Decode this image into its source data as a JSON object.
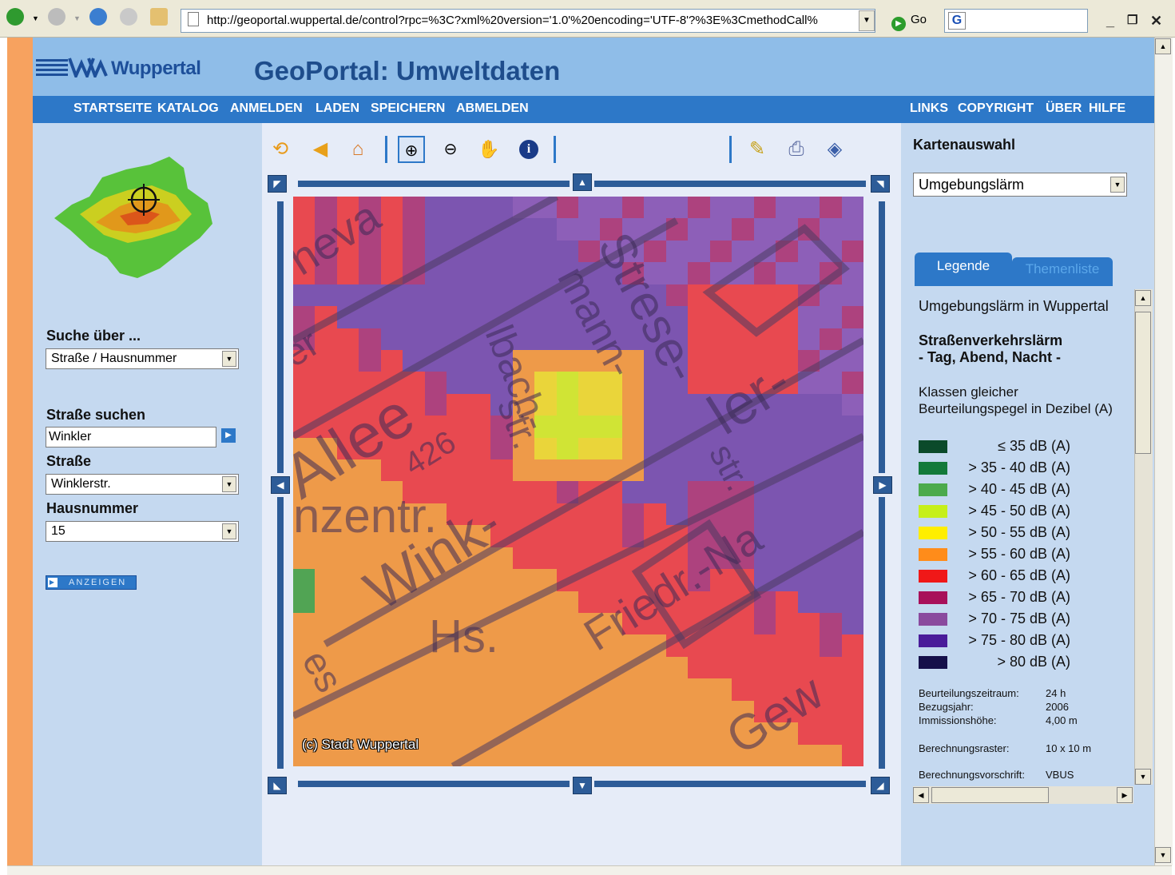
{
  "browser": {
    "url": "http://geoportal.wuppertal.de/control?rpc=%3C?xml%20version='1.0'%20encoding='UTF-8'?%3E%3CmethodCall%",
    "go_label": "Go"
  },
  "header": {
    "logo_text": "Wuppertal",
    "title": "GeoPortal: Umweltdaten"
  },
  "nav": {
    "left": [
      "STARTSEITE",
      "KATALOG",
      "ANMELDEN",
      "LADEN",
      "SPEICHERN",
      "ABMELDEN"
    ],
    "right": [
      "LINKS",
      "COPYRIGHT",
      "ÜBER",
      "HILFE"
    ]
  },
  "search": {
    "suche_label": "Suche über ...",
    "suche_value": "Straße / Hausnummer",
    "strasse_suchen_label": "Straße suchen",
    "strasse_suchen_value": "Winkler",
    "strasse_label": "Straße",
    "strasse_value": "Winklerstr.",
    "hausnummer_label": "Hausnummer",
    "hausnummer_value": "15",
    "anzeigen_label": "ANZEIGEN"
  },
  "map": {
    "copyright": "(c) Stadt Wuppertal",
    "labels": [
      "Allee",
      "Strese-",
      "mann-",
      "lbach-",
      "str.",
      "Wink-",
      "ler-",
      "str.",
      "Friedr.-Na",
      "Hs.",
      "nzentr.",
      "Gew",
      "heva",
      "426",
      "es",
      "er"
    ]
  },
  "kartenauswahl": {
    "title": "Kartenauswahl",
    "selected": "Umgebungslärm"
  },
  "tabs": {
    "legende": "Legende",
    "themenliste": "Themenliste"
  },
  "legend": {
    "title": "Umgebungslärm in Wuppertal",
    "subtitle1": "Straßenverkehrslärm",
    "subtitle2": "- Tag, Abend, Nacht -",
    "desc1": "Klassen gleicher",
    "desc2": "Beurteilungspegel in Dezibel (A)",
    "classes": [
      {
        "label": "≤ 35 dB (A)",
        "color": "#0b4a2a"
      },
      {
        "label": "> 35 - 40 dB (A)",
        "color": "#137a3a"
      },
      {
        "label": "> 40 - 45 dB (A)",
        "color": "#4caa4c"
      },
      {
        "label": "> 45 - 50 dB (A)",
        "color": "#c6ef1a"
      },
      {
        "label": "> 50 - 55 dB (A)",
        "color": "#ffee00"
      },
      {
        "label": "> 55 - 60 dB (A)",
        "color": "#ff8c1a"
      },
      {
        "label": "> 60 - 65 dB (A)",
        "color": "#f01818"
      },
      {
        "label": "> 65 - 70 dB (A)",
        "color": "#a8105a"
      },
      {
        "label": "> 70 - 75 dB (A)",
        "color": "#8a4a9e"
      },
      {
        "label": "> 75 - 80 dB (A)",
        "color": "#4a1c9a"
      },
      {
        "label": "> 80 dB (A)",
        "color": "#15104a"
      }
    ],
    "meta": [
      {
        "k": "Beurteilungszeitraum:",
        "v": "24 h"
      },
      {
        "k": "Bezugsjahr:",
        "v": "2006"
      },
      {
        "k": "Immissionshöhe:",
        "v": "4,00 m"
      },
      {
        "k": "Berechnungsraster:",
        "v": "10 x 10 m"
      },
      {
        "k": "Berechnungsvorschrift:",
        "v": "VBUS"
      }
    ]
  },
  "colors": {
    "accent": "#2d78c8",
    "banner": "#8fbde8",
    "panel": "#c5d9f0",
    "orange": "#f7a25f"
  }
}
